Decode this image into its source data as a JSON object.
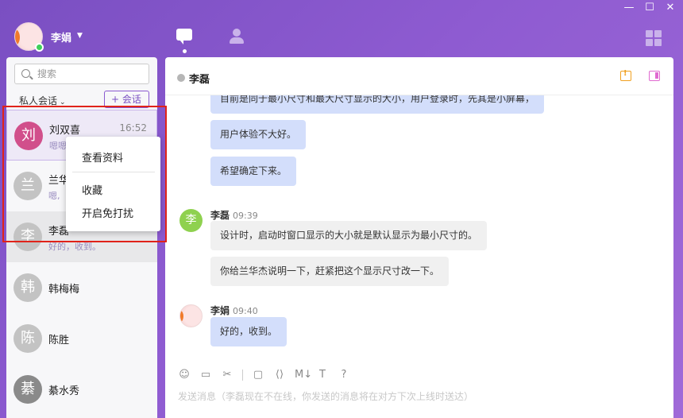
{
  "window": {
    "minimize": "—",
    "maximize": "☐",
    "close": "✕"
  },
  "user": {
    "name": "李娟",
    "status_color": "#3ecf5a"
  },
  "nav": {
    "icons": [
      "chat-icon",
      "contacts-icon",
      "apps-grid-icon"
    ]
  },
  "sidebar": {
    "search_placeholder": "搜索",
    "section_label": "私人会话",
    "new_button_label": "+ 会话",
    "conversations": [
      {
        "avatar": "刘",
        "name": "刘双喜",
        "time": "16:52",
        "preview": "嗯嗯",
        "color": "#d14f8b"
      },
      {
        "avatar": "兰",
        "name": "兰华杰",
        "time": "",
        "preview": "嗯,",
        "color": "#c3c3c3"
      },
      {
        "avatar": "李",
        "name": "李磊",
        "time": "",
        "preview": "好的，收到。",
        "color": "#c3c3c3"
      },
      {
        "avatar": "韩",
        "name": "韩梅梅",
        "color": "#c3c3c3"
      },
      {
        "avatar": "陈",
        "name": "陈胜",
        "color": "#c3c3c3"
      },
      {
        "avatar": "綦",
        "name": "綦水秀",
        "color": "#8a8a8a"
      }
    ]
  },
  "context_menu": {
    "items": [
      "查看资料",
      "收藏",
      "开启免打扰"
    ]
  },
  "chat": {
    "peer_name": "李磊",
    "messages": {
      "m0": "目前是同于最小尺寸和最大尺寸显示的大小，用户登录时，先其是小屏幕，",
      "m1": "用户体验不大好。",
      "m2": "希望确定下来。",
      "s1_name": "李磊",
      "s1_time": "09:39",
      "s1_avatar": "李",
      "m3": "设计时，启动时窗口显示的大小就是默认显示为最小尺寸的。",
      "m4": "你给兰华杰说明一下，赶紧把这个显示尺寸改一下。",
      "s2_name": "李娟",
      "s2_time": "09:40",
      "m5": "好的，收到。"
    },
    "compose_placeholder": "发送消息（李磊现在不在线，你发送的消息将在对方下次上线时送达）",
    "toolbar": {
      "emoji": "☺",
      "image": "▭",
      "cut": "✂",
      "folder": "▢",
      "code": "⟨⟩",
      "markdown": "M↓",
      "text": "T",
      "help": "?"
    }
  }
}
